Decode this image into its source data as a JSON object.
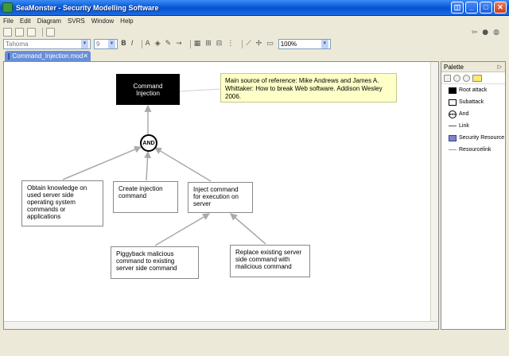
{
  "window": {
    "title": "SeaMonster - Security Modelling Software"
  },
  "menu": [
    "File",
    "Edit",
    "Diagram",
    "SVRS",
    "Window",
    "Help"
  ],
  "toolbar": {
    "font": "Tahoma",
    "font_size": "9",
    "zoom": "100%",
    "bold": "B",
    "italic": "I",
    "font_color": "A"
  },
  "editor_tab": {
    "label": "Command_Injection.mod"
  },
  "diagram": {
    "root": "Command Injection",
    "note": "Main source of reference: Mike Andrews and James A. Whittaker: How to break Web software. Addison Wesley 2006.",
    "and_label": "AND",
    "subattacks": [
      "Obtain knowledge on used server side operating system commands or applications",
      "Create injection command",
      "Inject command for execution on server",
      "Piggyback malicious command to existing server side command",
      "Replace existing server side command with malicious command"
    ]
  },
  "palette": {
    "title": "Palette",
    "items": [
      "Root attack",
      "Subattack",
      "And",
      "Link",
      "Security Resource",
      "Resourcelink"
    ],
    "and_glyph": "AND"
  }
}
